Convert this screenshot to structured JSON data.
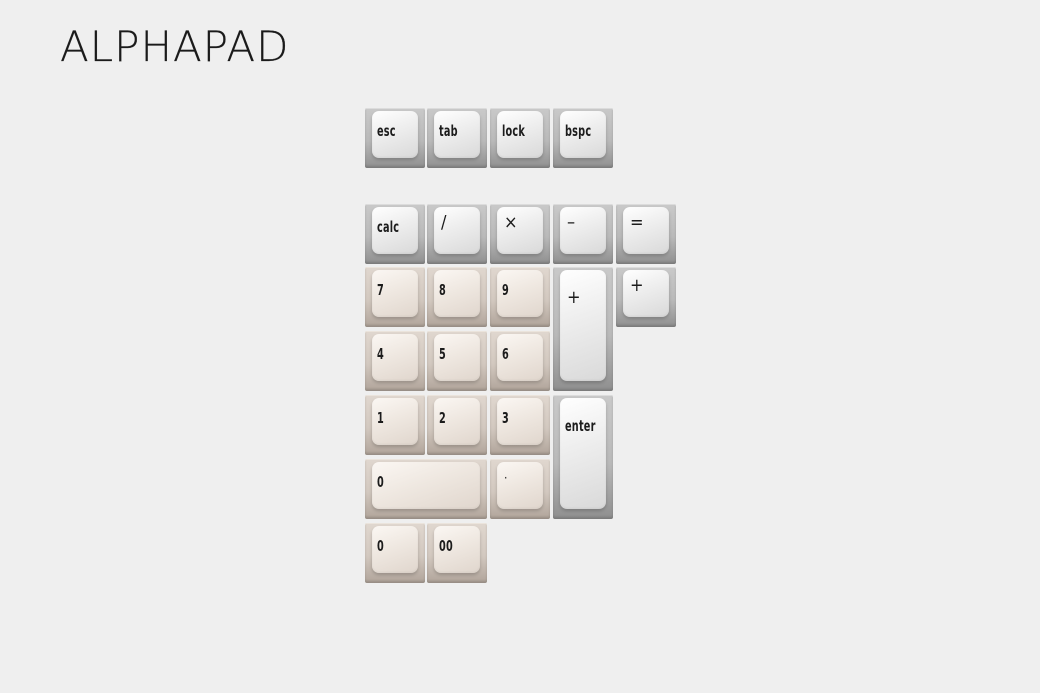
{
  "title": "ALPHAPAD",
  "colors": {
    "background": "#efefef",
    "gray_key": "#d9d9d9",
    "cream_key": "#efe8e1",
    "legend": "#1c1c1c"
  },
  "keys": {
    "esc": "esc",
    "tab": "tab",
    "lock": "lock",
    "bspc": "bspc",
    "calc": "calc",
    "slash": "/",
    "multiply": "×",
    "minus": "–",
    "equals": "=",
    "seven": "7",
    "eight": "8",
    "nine": "9",
    "plus_tall": "+",
    "plus_small": "+",
    "four": "4",
    "five": "5",
    "six": "6",
    "one": "1",
    "two": "2",
    "three": "3",
    "enter": "enter",
    "zero_wide": "0",
    "dot": "·",
    "zero": "0",
    "double_zero": "00"
  }
}
